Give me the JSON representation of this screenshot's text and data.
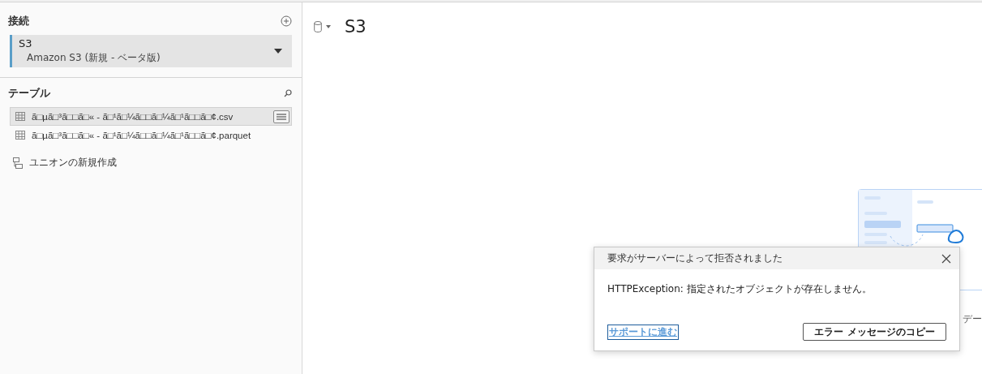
{
  "sidebar": {
    "connections": {
      "title": "接続",
      "items": [
        {
          "name": "S3",
          "type": "Amazon S3 (新規 - ベータ版)",
          "selected": true
        }
      ]
    },
    "tables": {
      "title": "テーブル",
      "items": [
        {
          "name": "ã□µã□³ã□□ã□« - ã□¹ã□¼ã□□ã□¼ã□¹ã□□ã□¢.csv",
          "selected": true
        },
        {
          "name": "ã□µã□³ã□□ã□« - ã□¹ã□¼ã□□ã□¼ã□¹ã□□ã□¢.parquet",
          "selected": false
        }
      ],
      "new_union": "ユニオンの新規作成"
    }
  },
  "main": {
    "title": "S3",
    "hint_text": "デー"
  },
  "dialog": {
    "title": "要求がサーバーによって拒否されました",
    "message": "HTTPException: 指定されたオブジェクトが存在しません。",
    "link": "サポートに進む",
    "button": "エラー メッセージのコピー"
  }
}
